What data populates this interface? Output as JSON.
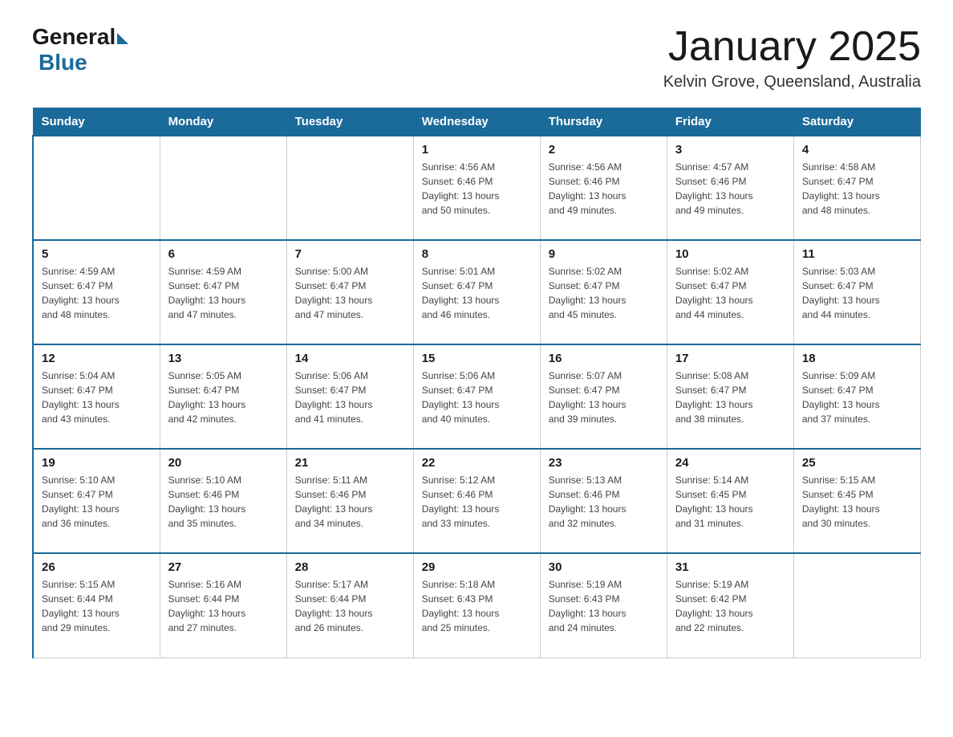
{
  "header": {
    "logo_general": "General",
    "logo_blue": "Blue",
    "month_title": "January 2025",
    "subtitle": "Kelvin Grove, Queensland, Australia"
  },
  "days_of_week": [
    "Sunday",
    "Monday",
    "Tuesday",
    "Wednesday",
    "Thursday",
    "Friday",
    "Saturday"
  ],
  "weeks": [
    [
      {
        "day": "",
        "info": ""
      },
      {
        "day": "",
        "info": ""
      },
      {
        "day": "",
        "info": ""
      },
      {
        "day": "1",
        "info": "Sunrise: 4:56 AM\nSunset: 6:46 PM\nDaylight: 13 hours\nand 50 minutes."
      },
      {
        "day": "2",
        "info": "Sunrise: 4:56 AM\nSunset: 6:46 PM\nDaylight: 13 hours\nand 49 minutes."
      },
      {
        "day": "3",
        "info": "Sunrise: 4:57 AM\nSunset: 6:46 PM\nDaylight: 13 hours\nand 49 minutes."
      },
      {
        "day": "4",
        "info": "Sunrise: 4:58 AM\nSunset: 6:47 PM\nDaylight: 13 hours\nand 48 minutes."
      }
    ],
    [
      {
        "day": "5",
        "info": "Sunrise: 4:59 AM\nSunset: 6:47 PM\nDaylight: 13 hours\nand 48 minutes."
      },
      {
        "day": "6",
        "info": "Sunrise: 4:59 AM\nSunset: 6:47 PM\nDaylight: 13 hours\nand 47 minutes."
      },
      {
        "day": "7",
        "info": "Sunrise: 5:00 AM\nSunset: 6:47 PM\nDaylight: 13 hours\nand 47 minutes."
      },
      {
        "day": "8",
        "info": "Sunrise: 5:01 AM\nSunset: 6:47 PM\nDaylight: 13 hours\nand 46 minutes."
      },
      {
        "day": "9",
        "info": "Sunrise: 5:02 AM\nSunset: 6:47 PM\nDaylight: 13 hours\nand 45 minutes."
      },
      {
        "day": "10",
        "info": "Sunrise: 5:02 AM\nSunset: 6:47 PM\nDaylight: 13 hours\nand 44 minutes."
      },
      {
        "day": "11",
        "info": "Sunrise: 5:03 AM\nSunset: 6:47 PM\nDaylight: 13 hours\nand 44 minutes."
      }
    ],
    [
      {
        "day": "12",
        "info": "Sunrise: 5:04 AM\nSunset: 6:47 PM\nDaylight: 13 hours\nand 43 minutes."
      },
      {
        "day": "13",
        "info": "Sunrise: 5:05 AM\nSunset: 6:47 PM\nDaylight: 13 hours\nand 42 minutes."
      },
      {
        "day": "14",
        "info": "Sunrise: 5:06 AM\nSunset: 6:47 PM\nDaylight: 13 hours\nand 41 minutes."
      },
      {
        "day": "15",
        "info": "Sunrise: 5:06 AM\nSunset: 6:47 PM\nDaylight: 13 hours\nand 40 minutes."
      },
      {
        "day": "16",
        "info": "Sunrise: 5:07 AM\nSunset: 6:47 PM\nDaylight: 13 hours\nand 39 minutes."
      },
      {
        "day": "17",
        "info": "Sunrise: 5:08 AM\nSunset: 6:47 PM\nDaylight: 13 hours\nand 38 minutes."
      },
      {
        "day": "18",
        "info": "Sunrise: 5:09 AM\nSunset: 6:47 PM\nDaylight: 13 hours\nand 37 minutes."
      }
    ],
    [
      {
        "day": "19",
        "info": "Sunrise: 5:10 AM\nSunset: 6:47 PM\nDaylight: 13 hours\nand 36 minutes."
      },
      {
        "day": "20",
        "info": "Sunrise: 5:10 AM\nSunset: 6:46 PM\nDaylight: 13 hours\nand 35 minutes."
      },
      {
        "day": "21",
        "info": "Sunrise: 5:11 AM\nSunset: 6:46 PM\nDaylight: 13 hours\nand 34 minutes."
      },
      {
        "day": "22",
        "info": "Sunrise: 5:12 AM\nSunset: 6:46 PM\nDaylight: 13 hours\nand 33 minutes."
      },
      {
        "day": "23",
        "info": "Sunrise: 5:13 AM\nSunset: 6:46 PM\nDaylight: 13 hours\nand 32 minutes."
      },
      {
        "day": "24",
        "info": "Sunrise: 5:14 AM\nSunset: 6:45 PM\nDaylight: 13 hours\nand 31 minutes."
      },
      {
        "day": "25",
        "info": "Sunrise: 5:15 AM\nSunset: 6:45 PM\nDaylight: 13 hours\nand 30 minutes."
      }
    ],
    [
      {
        "day": "26",
        "info": "Sunrise: 5:15 AM\nSunset: 6:44 PM\nDaylight: 13 hours\nand 29 minutes."
      },
      {
        "day": "27",
        "info": "Sunrise: 5:16 AM\nSunset: 6:44 PM\nDaylight: 13 hours\nand 27 minutes."
      },
      {
        "day": "28",
        "info": "Sunrise: 5:17 AM\nSunset: 6:44 PM\nDaylight: 13 hours\nand 26 minutes."
      },
      {
        "day": "29",
        "info": "Sunrise: 5:18 AM\nSunset: 6:43 PM\nDaylight: 13 hours\nand 25 minutes."
      },
      {
        "day": "30",
        "info": "Sunrise: 5:19 AM\nSunset: 6:43 PM\nDaylight: 13 hours\nand 24 minutes."
      },
      {
        "day": "31",
        "info": "Sunrise: 5:19 AM\nSunset: 6:42 PM\nDaylight: 13 hours\nand 22 minutes."
      },
      {
        "day": "",
        "info": ""
      }
    ]
  ]
}
